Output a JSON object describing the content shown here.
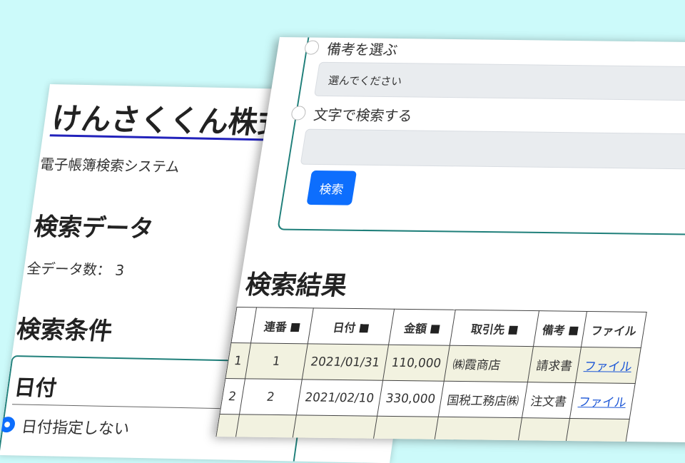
{
  "back_page": {
    "company_name": "けんさくくん株式会",
    "system_name": "電子帳簿検索システム",
    "search_data_heading": "検索データ",
    "total_label": "全データ数：",
    "total_count": "3",
    "conditions_heading": "検索条件",
    "date_section_title": "日付",
    "date_option_none": "日付指定しない"
  },
  "front_page": {
    "option_note": "備考を選ぶ",
    "note_select_placeholder": "選んでください",
    "option_text": "文字で検索する",
    "text_input_value": "",
    "search_button": "検索",
    "results_heading": "検索結果",
    "table": {
      "headers": [
        "",
        "連番",
        "日付",
        "金額",
        "取引先",
        "備考",
        "ファイル"
      ],
      "rows": [
        {
          "idx": "1",
          "seq": "1",
          "date": "2021/01/31",
          "amount": "110,000",
          "client": "㈱霞商店",
          "note": "請求書",
          "file": "ファイル"
        },
        {
          "idx": "2",
          "seq": "2",
          "date": "2021/02/10",
          "amount": "330,000",
          "client": "国税工務店㈱",
          "note": "注文書",
          "file": "ファイル"
        }
      ]
    }
  },
  "colors": {
    "background": "#ccfafa",
    "accent_blue": "#0d6efd",
    "box_border": "#1f7f7a",
    "link": "#1a55d6"
  }
}
